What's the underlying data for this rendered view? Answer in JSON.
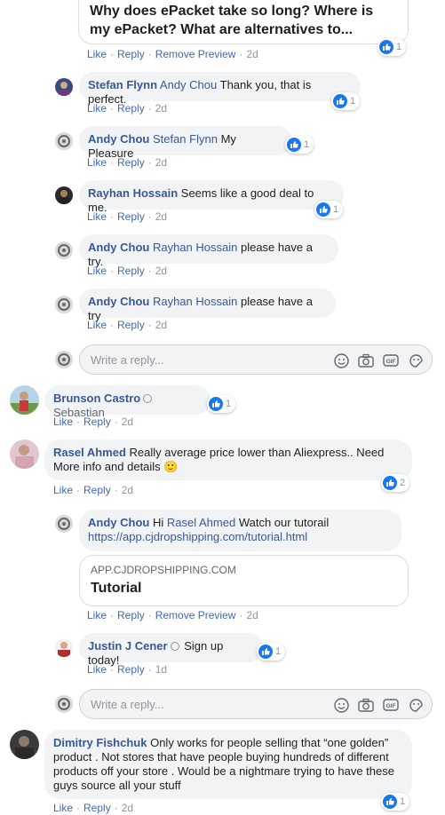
{
  "top_preview": {
    "title": "Why does ePacket take so long? Where is my ePacket? What are alternatives to...",
    "reaction_count": "1",
    "actions": {
      "like": "Like",
      "reply": "Reply",
      "remove_preview": "Remove Preview",
      "time": "2d"
    }
  },
  "comments": [
    {
      "name": "Stefan Flynn",
      "tag": "Andy Chou",
      "text": "Thank you, that is perfect.",
      "reaction_count": "1",
      "like": "Like",
      "reply": "Reply",
      "time": "2d"
    },
    {
      "name": "Andy Chou",
      "tag": "Stefan Flynn",
      "text": "My Pleasure",
      "reaction_count": "1",
      "like": "Like",
      "reply": "Reply",
      "time": "2d"
    },
    {
      "name": "Rayhan Hossain",
      "text": "Seems like a good deal to me.",
      "reaction_count": "1",
      "like": "Like",
      "reply": "Reply",
      "time": "2d"
    },
    {
      "name": "Andy Chou",
      "tag": "Rayhan Hossain",
      "text": "please have a try.",
      "like": "Like",
      "reply": "Reply",
      "time": "2d"
    },
    {
      "name": "Andy Chou",
      "tag": "Rayhan Hossain",
      "text": "please have a try",
      "like": "Like",
      "reply": "Reply",
      "time": "2d"
    },
    {
      "name": "Brunson Castro",
      "tag": "Sebastian",
      "reaction_count": "1",
      "like": "Like",
      "reply": "Reply",
      "time": "2d"
    },
    {
      "name": "Rasel Ahmed",
      "text": "Really average price lower than Aliexpress.. Need More info and details",
      "emoji": "🙂",
      "reaction_count": "2",
      "like": "Like",
      "reply": "Reply",
      "time": "2d"
    },
    {
      "name": "Andy Chou",
      "prefix": "Hi",
      "tag": "Rasel Ahmed",
      "text": "Watch our tutorail",
      "link": "https://app.cjdropshipping.com/tutorial.html"
    },
    {
      "name": "Justin J Cener",
      "text": "Sign up today!",
      "reaction_count": "1",
      "like": "Like",
      "reply": "Reply",
      "time": "1d"
    },
    {
      "name": "Dimitry Fishchuk",
      "text": "Only works for people selling that “one golden” product . Not stores that have people buying hundreds of different products off your store . Would be a nightmare trying to have these guys source all your stuff",
      "reaction_count": "1",
      "like": "Like",
      "reply": "Reply",
      "time": "2d"
    }
  ],
  "link_preview": {
    "domain": "APP.CJDROPSHIPPING.COM",
    "title": "Tutorial",
    "actions": {
      "like": "Like",
      "reply": "Reply",
      "remove_preview": "Remove Preview",
      "time": "2d"
    }
  },
  "reply_box": {
    "placeholder": "Write a reply..."
  },
  "colors": {
    "name_blue": "#385898",
    "action_blue": "#4267b2",
    "bubble_bg": "#f2f3f5",
    "like_blue": "#1877f2"
  },
  "icons": [
    "like-icon",
    "emoji-icon",
    "camera-icon",
    "gif-icon",
    "sticker-icon",
    "verified-icon"
  ]
}
